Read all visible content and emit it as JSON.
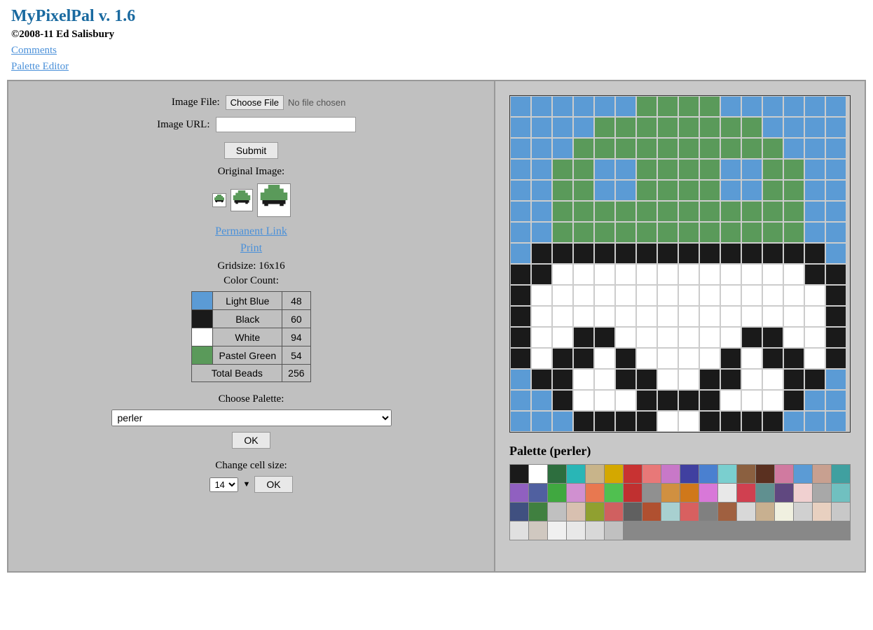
{
  "header": {
    "title": "MyPixelPal v. 1.6",
    "copyright": "©2008-11 Ed Salisbury",
    "links": [
      {
        "label": "Comments",
        "id": "comments-link"
      },
      {
        "label": "Palette Editor",
        "id": "palette-editor-link"
      }
    ]
  },
  "left_panel": {
    "image_file_label": "Image File:",
    "choose_file_btn": "Choose File",
    "no_file_text": "No file chosen",
    "image_url_label": "Image URL:",
    "image_url_value": "",
    "image_url_placeholder": "",
    "submit_btn": "Submit",
    "original_image_label": "Original Image:",
    "permanent_link": "Permanent Link",
    "print_link": "Print",
    "gridsize_label": "Gridsize: 16x16",
    "color_count_label": "Color Count:",
    "colors": [
      {
        "name": "Light Blue",
        "count": "48",
        "hex": "#5b9bd5"
      },
      {
        "name": "Black",
        "count": "60",
        "hex": "#1a1a1a"
      },
      {
        "name": "White",
        "count": "94",
        "hex": "#ffffff"
      },
      {
        "name": "Pastel Green",
        "count": "54",
        "hex": "#5a9a5a"
      }
    ],
    "total_label": "Total Beads",
    "total_count": "256",
    "choose_palette_label": "Choose Palette:",
    "palette_options": [
      {
        "value": "perler",
        "label": "perler"
      }
    ],
    "palette_selected": "perler",
    "ok_btn": "OK",
    "cell_size_label": "Change cell size:",
    "cell_size_value": "14",
    "cell_size_ok": "OK"
  },
  "right_panel": {
    "palette_title": "Palette (perler)",
    "pixel_grid": {
      "rows": 16,
      "cols": 16,
      "colors": [
        "B",
        "B",
        "B",
        "B",
        "B",
        "W",
        "W",
        "W",
        "G",
        "G",
        "G",
        "W",
        "B",
        "B",
        "B",
        "B",
        "B",
        "B",
        "B",
        "W",
        "W",
        "W",
        "W",
        "W",
        "W",
        "W",
        "W",
        "W",
        "W",
        "B",
        "B",
        "B",
        "B",
        "B",
        "W",
        "W",
        "W",
        "W",
        "W",
        "W",
        "W",
        "W",
        "W",
        "W",
        "W",
        "W",
        "B",
        "B",
        "B",
        "G",
        "W",
        "W",
        "W",
        "W",
        "W",
        "W",
        "W",
        "W",
        "W",
        "W",
        "W",
        "W",
        "G",
        "B",
        "G",
        "W",
        "W",
        "W",
        "W",
        "W",
        "W",
        "W",
        "W",
        "W",
        "W",
        "W",
        "W",
        "W",
        "W",
        "G",
        "W",
        "W",
        "W",
        "W",
        "W",
        "W",
        "W",
        "W",
        "W",
        "W",
        "W",
        "W",
        "W",
        "W",
        "W",
        "W",
        "W",
        "W",
        "W",
        "W",
        "W",
        "W",
        "W",
        "W",
        "W",
        "W",
        "W",
        "W",
        "W",
        "W",
        "W",
        "W",
        "B",
        "K",
        "K",
        "W",
        "W",
        "W",
        "W",
        "W",
        "W",
        "W",
        "W",
        "W",
        "W",
        "K",
        "K",
        "B",
        "B",
        "K",
        "K",
        "W",
        "W",
        "W",
        "W",
        "W",
        "W",
        "W",
        "W",
        "W",
        "W",
        "K",
        "K",
        "B",
        "B",
        "K",
        "W",
        "K",
        "K",
        "W",
        "W",
        "W",
        "W",
        "W",
        "W",
        "K",
        "K",
        "W",
        "K",
        "B",
        "B",
        "K",
        "W",
        "W",
        "K",
        "K",
        "W",
        "W",
        "W",
        "W",
        "K",
        "K",
        "W",
        "W",
        "K",
        "B",
        "B",
        "K",
        "W",
        "W",
        "W",
        "K",
        "K",
        "W",
        "W",
        "K",
        "K",
        "W",
        "W",
        "W",
        "K",
        "B",
        "L",
        "K",
        "K",
        "K",
        "K",
        "K",
        "K",
        "W",
        "W",
        "K",
        "K",
        "K",
        "K",
        "K",
        "K",
        "L",
        "L",
        "L",
        "L",
        "L",
        "L",
        "K",
        "K",
        "W",
        "W",
        "K",
        "K",
        "L",
        "L",
        "L",
        "L",
        "L",
        "L",
        "L",
        "L",
        "L",
        "L",
        "K",
        "K",
        "W",
        "W",
        "K",
        "K",
        "L",
        "L",
        "L",
        "L",
        "L",
        "L",
        "L",
        "L",
        "L",
        "L",
        "K",
        "W",
        "W",
        "W",
        "W",
        "K",
        "L",
        "L",
        "L",
        "L",
        "L"
      ]
    },
    "palette_colors": [
      "#1a1a1a",
      "#ffffff",
      "#2d6e3e",
      "#29b6b6",
      "#c8b48a",
      "#d4a800",
      "#c83232",
      "#e87878",
      "#c878c8",
      "#4040a0",
      "#4a80d0",
      "#7acfcf",
      "#8b6040",
      "#5a3020",
      "#d07aa0",
      "#5b9bd5",
      "#c8a090",
      "#40a0a0",
      "#b060c8",
      "#6060a0",
      "#40a840",
      "#d090d0",
      "#e87850",
      "#40c040",
      "#c03030",
      "#909090",
      "#d09040",
      "#d0781a",
      "#d878d8",
      "#d04050",
      "#609090",
      "#604880",
      "#d8d8d8",
      "#a8a8a8",
      "#e8e8e8"
    ]
  }
}
